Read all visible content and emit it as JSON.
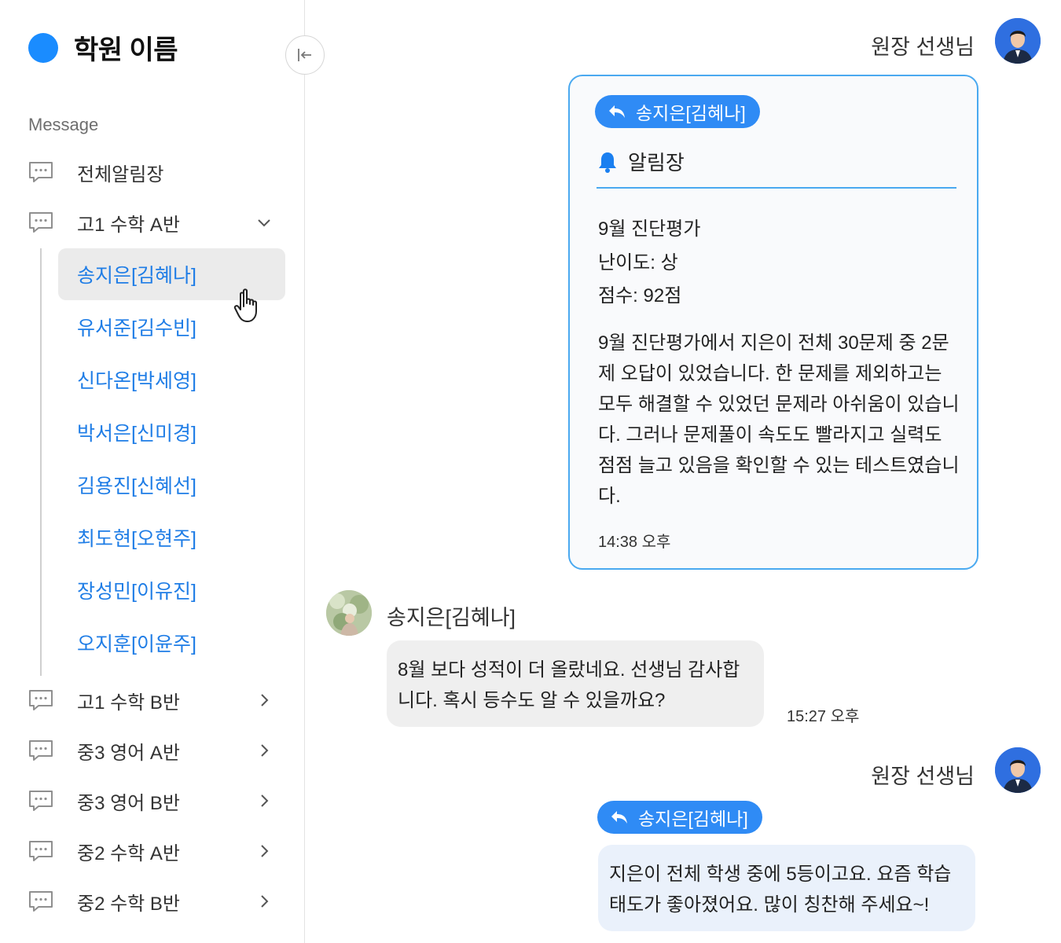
{
  "sidebar": {
    "brand": "학원 이름",
    "section_label": "Message",
    "top_items": [
      {
        "label": "전체알림장"
      },
      {
        "label": "고1 수학 A반"
      }
    ],
    "students": [
      {
        "label": "송지은[김혜나]"
      },
      {
        "label": "유서준[김수빈]"
      },
      {
        "label": "신다온[박세영]"
      },
      {
        "label": "박서은[신미경]"
      },
      {
        "label": "김용진[신혜선]"
      },
      {
        "label": "최도현[오현주]"
      },
      {
        "label": "장성민[이유진]"
      },
      {
        "label": "오지훈[이윤주]"
      }
    ],
    "bottom_items": [
      {
        "label": "고1 수학 B반"
      },
      {
        "label": "중3 영어 A반"
      },
      {
        "label": "중3 영어 B반"
      },
      {
        "label": "중2 수학 A반"
      },
      {
        "label": "중2 수학 B반"
      }
    ]
  },
  "chat": {
    "teacher_name": "원장 선생님",
    "notice": {
      "reply_to": "송지은[김혜나]",
      "title": "알림장",
      "lines": [
        "9월 진단평가",
        "난이도: 상",
        "점수: 92점"
      ],
      "body": "9월 진단평가에서 지은이 전체 30문제 중 2문제 오답이 있었습니다. 한 문제를 제외하고는 모두 해결할 수 있었던 문제라 아쉬움이 있습니다. 그러나 문제풀이 속도도 빨라지고 실력도 점점 늘고 있음을 확인할 수 있는 테스트였습니다.",
      "time": "14:38 오후"
    },
    "student_message": {
      "sender": "송지은[김혜나]",
      "text": "8월 보다 성적이 더 올랐네요. 선생님 감사합니다. 혹시 등수도 알 수 있을까요?",
      "time": "15:27 오후"
    },
    "reply_message": {
      "reply_to": "송지은[김혜나]",
      "text": "지은이 전체 학생 중에 5등이고요. 요즘 학습태도가 좋아졌어요. 많이 칭찬해 주세요~!"
    }
  },
  "colors": {
    "accent": "#1a8cff",
    "chip": "#2f8bf5",
    "card_border": "#4aa9f0",
    "student_link": "#1f7de6"
  },
  "icons": {
    "chat": "chat-bubble-dots-icon",
    "chevron_down": "chevron-down-icon",
    "chevron_right": "chevron-right-icon",
    "collapse": "collapse-left-icon",
    "reply": "reply-arrow-icon",
    "bell": "bell-icon",
    "cursor": "hand-pointer-icon"
  }
}
